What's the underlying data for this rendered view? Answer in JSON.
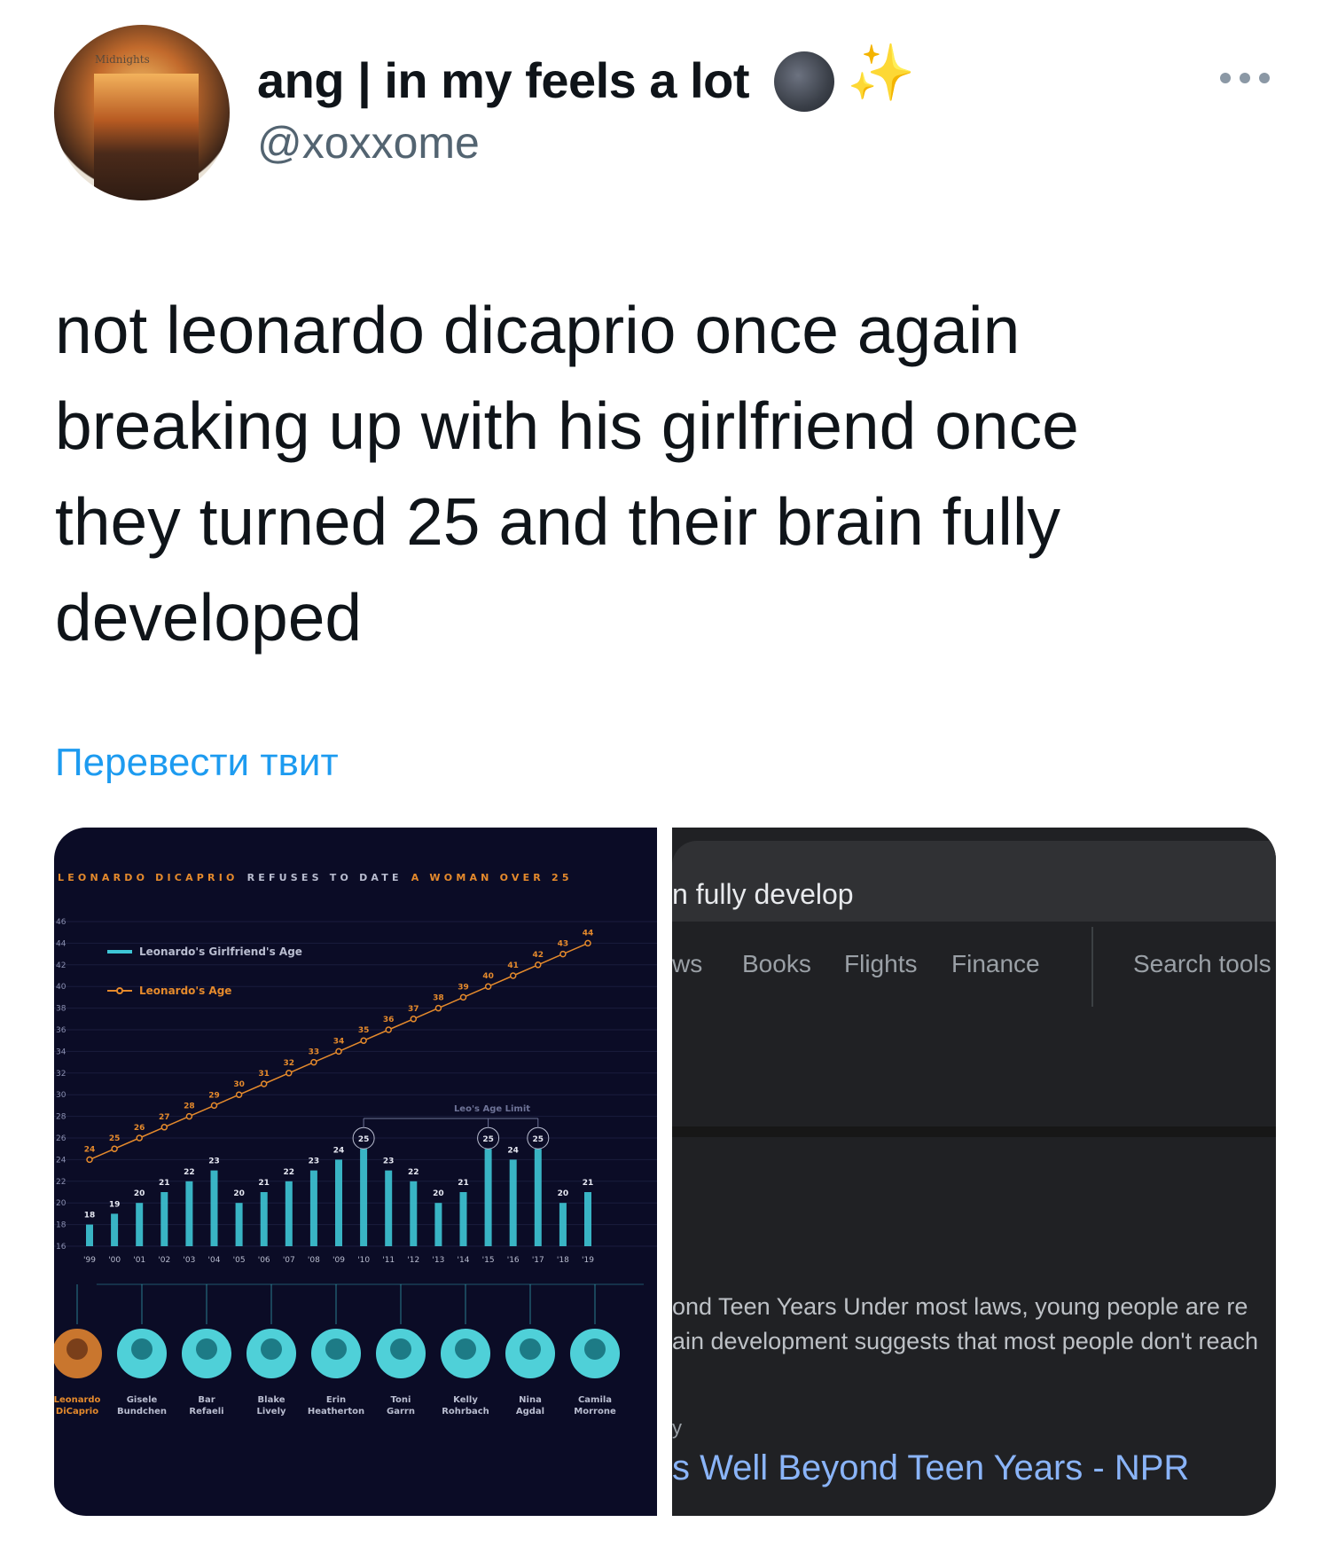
{
  "tweet": {
    "avatar_caption": "Midnights",
    "display_name": "ang | in my feels a lot",
    "emoji_moon": "new-moon-face",
    "emoji_sparkles": "✨",
    "handle": "@xoxxome",
    "text_lines": [
      "not leonardo dicaprio once again",
      "breaking up with his girlfriend once",
      "they turned 25 and their brain fully",
      "developed"
    ],
    "translate_link": "Перевести твит",
    "more_icon": "more-horizontal-icon"
  },
  "chart_title": {
    "part1": "LEONARDO DICAPRIO",
    "part2": "REFUSES TO DATE",
    "part3": "A WOMAN OVER 25"
  },
  "chart_data": {
    "type": "bar",
    "title": "LEONARDO DICAPRIO REFUSES TO DATE A WOMAN OVER 25",
    "x": [
      "'99",
      "'00",
      "'01",
      "'02",
      "'03",
      "'04",
      "'05",
      "'06",
      "'07",
      "'08",
      "'09",
      "'10",
      "'11",
      "'12",
      "'13",
      "'14",
      "'15",
      "'16",
      "'17",
      "'18",
      "'19"
    ],
    "ylim": [
      16,
      46
    ],
    "y_ticks": [
      46,
      44,
      42,
      40,
      38,
      36,
      34,
      32,
      30,
      28,
      26,
      24,
      22,
      20,
      18,
      16
    ],
    "series": [
      {
        "name": "Leonardo's Girlfriend's Age",
        "type": "bar",
        "values": [
          18,
          19,
          20,
          21,
          22,
          23,
          20,
          21,
          22,
          23,
          24,
          25,
          23,
          22,
          20,
          21,
          25,
          24,
          25,
          20,
          21
        ]
      },
      {
        "name": "Leonardo's Age",
        "type": "line",
        "values": [
          24,
          25,
          26,
          27,
          28,
          29,
          30,
          31,
          32,
          33,
          34,
          35,
          36,
          37,
          38,
          39,
          40,
          41,
          42,
          43,
          44
        ]
      }
    ],
    "annotations": {
      "limit_label": "Leo's Age Limit",
      "limit_value": 25
    },
    "legend": "top-left",
    "grid": true,
    "people": [
      {
        "first": "Leonardo",
        "last": "DiCaprio"
      },
      {
        "first": "Gisele",
        "last": "Bundchen"
      },
      {
        "first": "Bar",
        "last": "Refaeli"
      },
      {
        "first": "Blake",
        "last": "Lively"
      },
      {
        "first": "Erin",
        "last": "Heatherton"
      },
      {
        "first": "Toni",
        "last": "Garrn"
      },
      {
        "first": "Kelly",
        "last": "Rohrbach"
      },
      {
        "first": "Nina",
        "last": "Agdal"
      },
      {
        "first": "Camila",
        "last": "Morrone"
      }
    ],
    "colors": {
      "bar": "#3ec6d6",
      "line": "#e58a2c",
      "background": "#0b0c26"
    }
  },
  "google": {
    "query": "n fully develop",
    "tabs": [
      "ws",
      "Books",
      "Flights",
      "Finance",
      "Search tools"
    ],
    "snippet_line1": "ond Teen Years Under most laws, young people are re",
    "snippet_line2": "ain development suggests that most people don't reach",
    "small_text": "y",
    "result_title": "s Well Beyond Teen Years - NPR"
  }
}
